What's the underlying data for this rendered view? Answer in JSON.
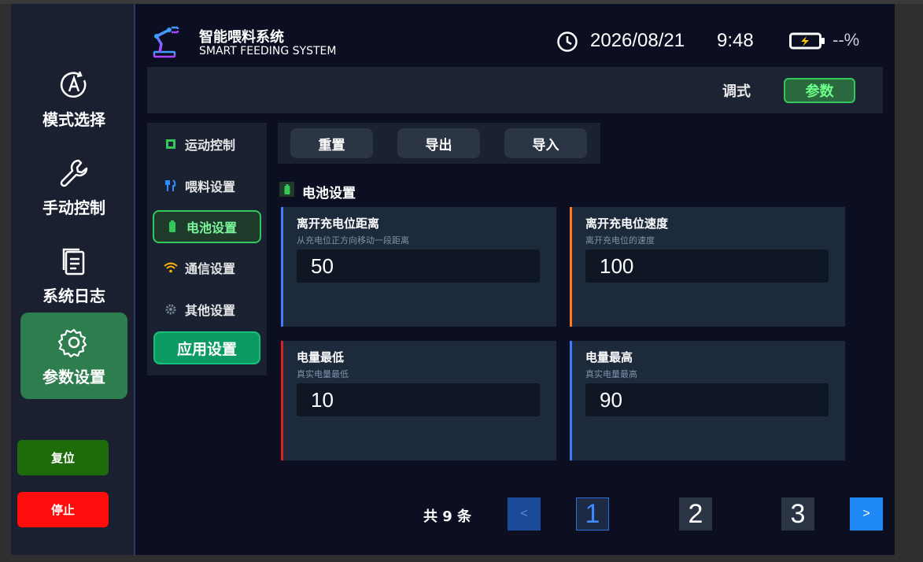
{
  "header": {
    "title": "智能喂料系统",
    "subtitle": "SMART FEEDING SYSTEM",
    "date": "2026/08/21",
    "time": "9:48",
    "battery": "--%"
  },
  "sidebar": {
    "items": [
      {
        "label": "模式选择",
        "icon": "mode-icon"
      },
      {
        "label": "手动控制",
        "icon": "wrench-icon"
      },
      {
        "label": "系统日志",
        "icon": "log-icon"
      },
      {
        "label": "参数设置",
        "icon": "gear-icon"
      }
    ],
    "reset_label": "复位",
    "stop_label": "停止"
  },
  "modes": {
    "debug": "调式",
    "param": "参数"
  },
  "subnav": {
    "items": [
      {
        "label": "运动控制",
        "icon": "chip-icon"
      },
      {
        "label": "喂料设置",
        "icon": "utensils-icon"
      },
      {
        "label": "电池设置",
        "icon": "battery-icon"
      },
      {
        "label": "通信设置",
        "icon": "wifi-icon"
      },
      {
        "label": "其他设置",
        "icon": "gear-icon"
      }
    ],
    "apply_label": "应用设置"
  },
  "toolbar": {
    "reset": "重置",
    "export": "导出",
    "import": "导入"
  },
  "section": {
    "title": "电池设置"
  },
  "cards": [
    {
      "title": "离开充电位距离",
      "subtitle": "从充电位正方向移动一段距离",
      "value": "50",
      "accent": "#3d7bff"
    },
    {
      "title": "离开充电位速度",
      "subtitle": "离开充电位的速度",
      "value": "100",
      "accent": "#ff7a1a"
    },
    {
      "title": "电量最低",
      "subtitle": "真实电量最低",
      "value": "10",
      "accent": "#e02020"
    },
    {
      "title": "电量最高",
      "subtitle": "真实电量最高",
      "value": "90",
      "accent": "#3d7bff"
    }
  ],
  "pagination": {
    "total": "共 9 条",
    "prev": "<",
    "pages": [
      "1",
      "2",
      "3"
    ],
    "next": ">"
  }
}
